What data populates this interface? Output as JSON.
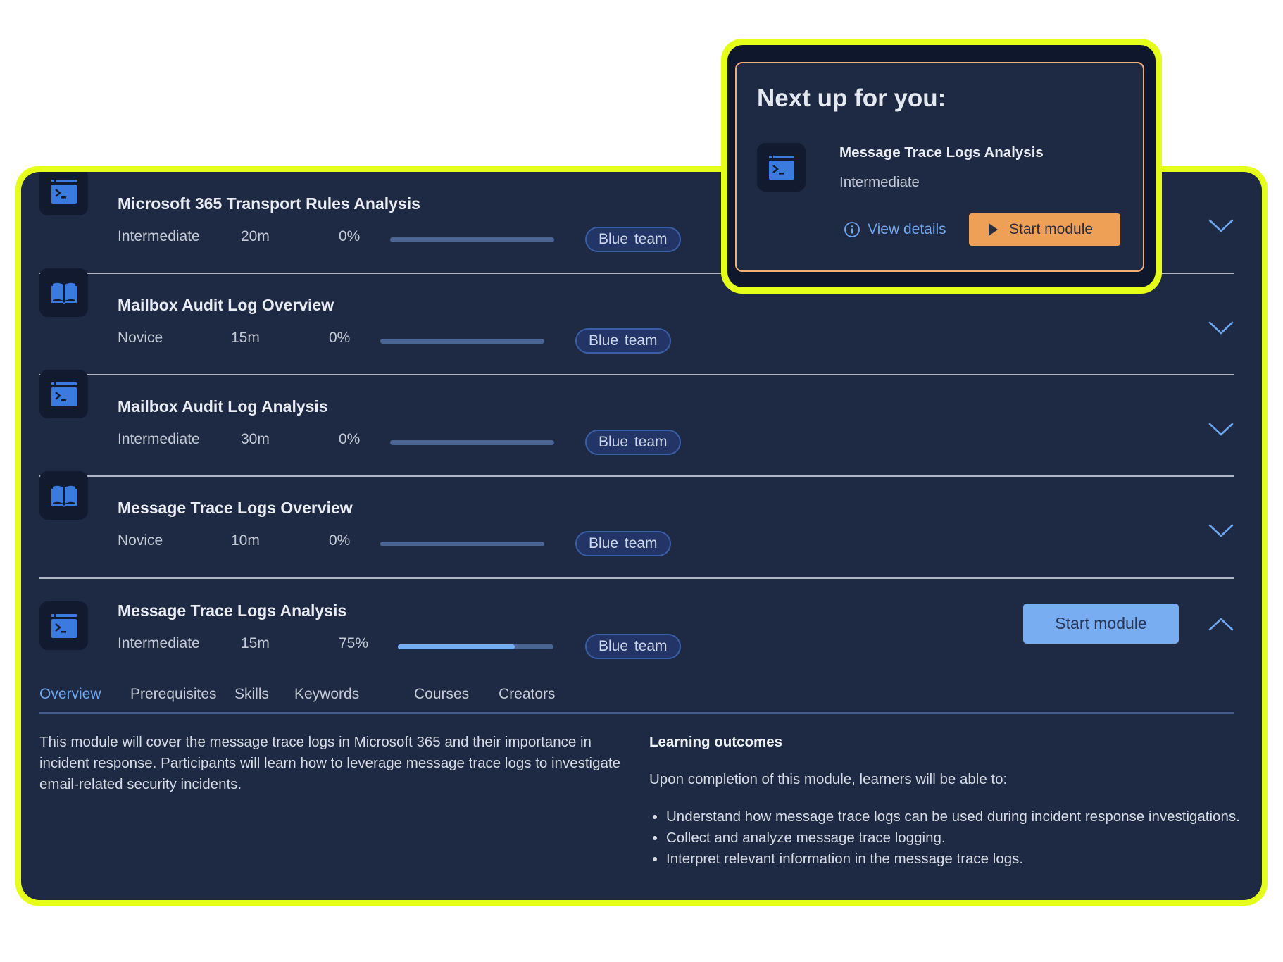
{
  "colors": {
    "highlight": "#e6ff1a",
    "panel_bg": "#1e2943",
    "accent_blue": "#76aef2",
    "accent_orange": "#eea057"
  },
  "modules": [
    {
      "title": "Microsoft 365 Transport Rules Analysis",
      "level": "Intermediate",
      "duration": "20m",
      "progress_label": "0%",
      "progress": 0,
      "tag": "Blue team",
      "icon": "terminal-window-icon",
      "expanded": false
    },
    {
      "title": "Mailbox Audit Log Overview",
      "level": "Novice",
      "duration": "15m",
      "progress_label": "0%",
      "progress": 0,
      "tag": "Blue team",
      "icon": "book-icon",
      "expanded": false
    },
    {
      "title": "Mailbox Audit Log Analysis",
      "level": "Intermediate",
      "duration": "30m",
      "progress_label": "0%",
      "progress": 0,
      "tag": "Blue team",
      "icon": "terminal-window-icon",
      "expanded": false
    },
    {
      "title": "Message Trace Logs Overview",
      "level": "Novice",
      "duration": "10m",
      "progress_label": "0%",
      "progress": 0,
      "tag": "Blue team",
      "icon": "book-icon",
      "expanded": false
    },
    {
      "title": "Message Trace Logs Analysis",
      "level": "Intermediate",
      "duration": "15m",
      "progress_label": "75%",
      "progress": 0.75,
      "tag": "Blue team",
      "icon": "terminal-window-icon",
      "expanded": true,
      "start_label": "Start module"
    }
  ],
  "detail": {
    "tabs": [
      "Overview",
      "Prerequisites",
      "Skills",
      "Keywords",
      "Courses",
      "Creators"
    ],
    "active_tab": "Overview",
    "description": "This module will cover the message trace logs in Microsoft 365 and their importance in incident response. Participants will learn how to leverage message trace logs to investigate email-related security incidents.",
    "outcomes_heading": "Learning outcomes",
    "outcomes_intro": "Upon completion of this module, learners will be able to:",
    "outcomes": [
      "Understand how message trace logs can be used during incident response investigations.",
      "Collect and analyze message trace logging.",
      "Interpret relevant information in the message trace logs."
    ]
  },
  "next_up": {
    "heading": "Next up for you:",
    "module_title": "Message Trace Logs Analysis",
    "module_level": "Intermediate",
    "view_details_label": "View details",
    "start_label": "Start module"
  }
}
